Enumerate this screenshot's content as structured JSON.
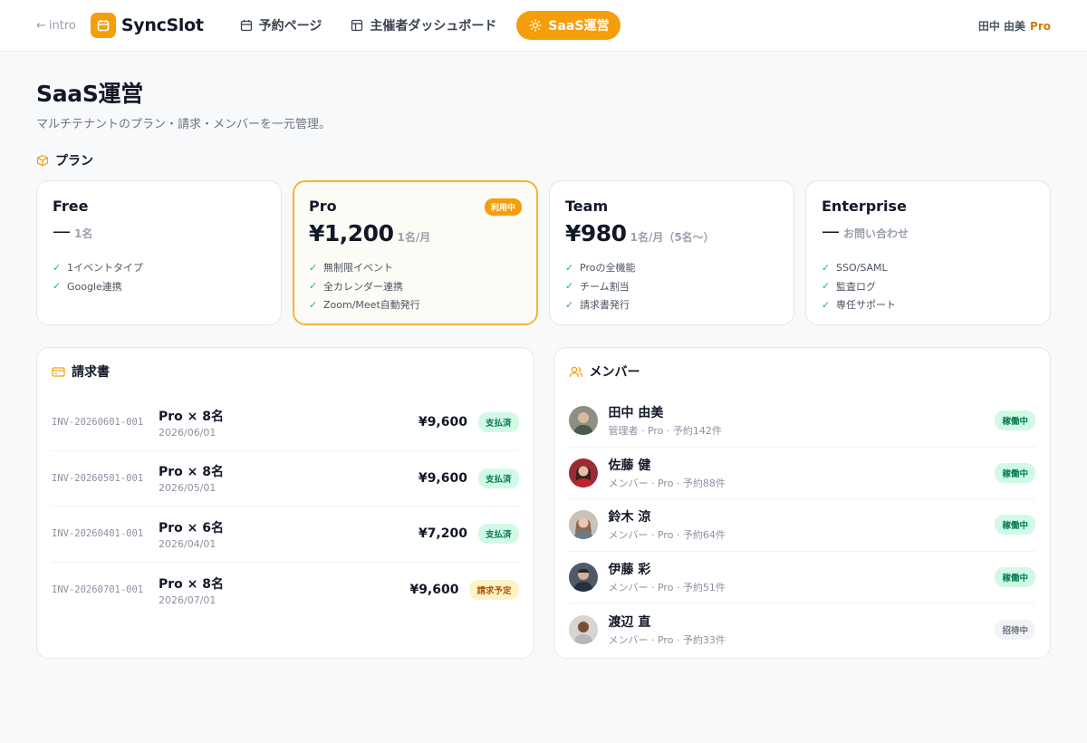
{
  "nav": {
    "back_label": "intro",
    "app_name": "SyncSlot",
    "items": [
      {
        "label": "予約ページ",
        "icon": "calendar-icon"
      },
      {
        "label": "主催者ダッシュボード",
        "icon": "dashboard-icon"
      },
      {
        "label": "SaaS運営",
        "icon": "sun-icon",
        "active": true
      }
    ],
    "user_name": "田中 由美",
    "user_plan": "Pro"
  },
  "page": {
    "title": "SaaS運営",
    "subtitle": "マルチテナントのプラン・請求・メンバーを一元管理。"
  },
  "plans_section": {
    "title": "プラン",
    "plans": [
      {
        "name": "Free",
        "price": "—",
        "unit": "1名",
        "features": [
          "1イベントタイプ",
          "Google連携"
        ]
      },
      {
        "name": "Pro",
        "price": "¥1,200",
        "unit": "1名/月",
        "badge": "利用中",
        "features": [
          "無制限イベント",
          "全カレンダー連携",
          "Zoom/Meet自動発行"
        ]
      },
      {
        "name": "Team",
        "price": "¥980",
        "unit": "1名/月（5名〜）",
        "features": [
          "Proの全機能",
          "チーム割当",
          "請求書発行"
        ]
      },
      {
        "name": "Enterprise",
        "price": "—",
        "unit": "お問い合わせ",
        "features": [
          "SSO/SAML",
          "監査ログ",
          "専任サポート"
        ]
      }
    ]
  },
  "invoices": {
    "title": "請求書",
    "rows": [
      {
        "id": "INV-20260601-001",
        "plan": "Pro × 8名",
        "date": "2026/06/01",
        "amount": "¥9,600",
        "status": "支払済",
        "kind": "paid"
      },
      {
        "id": "INV-20260501-001",
        "plan": "Pro × 8名",
        "date": "2026/05/01",
        "amount": "¥9,600",
        "status": "支払済",
        "kind": "paid"
      },
      {
        "id": "INV-20260401-001",
        "plan": "Pro × 6名",
        "date": "2026/04/01",
        "amount": "¥7,200",
        "status": "支払済",
        "kind": "paid"
      },
      {
        "id": "INV-20260701-001",
        "plan": "Pro × 8名",
        "date": "2026/07/01",
        "amount": "¥9,600",
        "status": "請求予定",
        "kind": "sched"
      }
    ]
  },
  "members": {
    "title": "メンバー",
    "rows": [
      {
        "name": "田中 由美",
        "meta": "管理者 · Pro · 予約142件",
        "status": "稼働中",
        "kind": "paid",
        "avatar_color": "#8d8f86"
      },
      {
        "name": "佐藤 健",
        "meta": "メンバー · Pro · 予約88件",
        "status": "稼働中",
        "kind": "paid",
        "avatar_color": "#9b2b35"
      },
      {
        "name": "鈴木 涼",
        "meta": "メンバー · Pro · 予約64件",
        "status": "稼働中",
        "kind": "paid",
        "avatar_color": "#b89a7e"
      },
      {
        "name": "伊藤 彩",
        "meta": "メンバー · Pro · 予約51件",
        "status": "稼働中",
        "kind": "paid",
        "avatar_color": "#4f5a66"
      },
      {
        "name": "渡辺 直",
        "meta": "メンバー · Pro · 予約33件",
        "status": "招待中",
        "kind": "gray",
        "avatar_color": "#7a4e36"
      }
    ]
  }
}
